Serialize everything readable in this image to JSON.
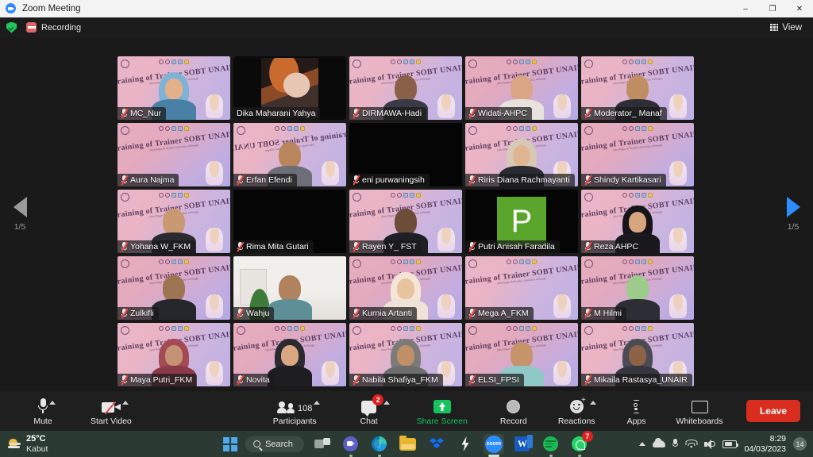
{
  "window": {
    "title": "Zoom Meeting",
    "app_icon": "zoom-logo-icon",
    "minimize": "–",
    "maximize": "❐",
    "close": "✕"
  },
  "topbar": {
    "encryption_icon": "green-shield-icon",
    "recording_icon": "recording-indicator-icon",
    "recording_label": "Recording",
    "view_label": "View",
    "view_icon": "grid-view-icon"
  },
  "gallery": {
    "virtual_background_title": "Training of Trainer SOBT UNAIR",
    "virtual_background_subtitle": "Sehat Bugar & Healthy Universitas Airlangga",
    "page_left": "1/5",
    "page_right": "1/5",
    "prev_icon": "chevron-left-icon",
    "next_icon": "chevron-right-icon",
    "participants": [
      {
        "name": "MC_Nur",
        "muted": true,
        "video": "vbg",
        "variant": "hijab",
        "skin": "#e3b089",
        "cloth": "#4a7fa6",
        "hijabcolor": "#7fb3d5"
      },
      {
        "name": "Dika Maharani Yahya",
        "muted": false,
        "video": "image",
        "active_speaker": true
      },
      {
        "name": "DIRMAWA-Hadi",
        "muted": true,
        "video": "vbg",
        "variant": "head",
        "skin": "#8a6148",
        "cloth": "#3a3a46"
      },
      {
        "name": "Widati-AHPC",
        "muted": true,
        "video": "vbg",
        "variant": "head",
        "skin": "#d9a585",
        "cloth": "#e8e2dd"
      },
      {
        "name": "Moderator_ Manaf",
        "muted": true,
        "video": "vbg",
        "variant": "head",
        "skin": "#c08e63",
        "cloth": "#2e2e38"
      },
      {
        "name": "Aura Najma",
        "muted": true,
        "video": "vbg",
        "variant": "none"
      },
      {
        "name": "Erfan Efendi",
        "muted": true,
        "video": "vbg_flip",
        "variant": "head",
        "skin": "#b9855c",
        "cloth": "#6e6e78"
      },
      {
        "name": "eni purwaningsih",
        "muted": true,
        "video": "off"
      },
      {
        "name": "Riris Diana Rachmayanti",
        "muted": true,
        "video": "vbg",
        "variant": "hijab",
        "skin": "#e0b591",
        "cloth": "#2b2b33",
        "hijabcolor": "#d8c9b6"
      },
      {
        "name": "Shindy Kartikasari",
        "muted": true,
        "video": "vbg",
        "variant": "none"
      },
      {
        "name": "Yohana W_FKM",
        "muted": true,
        "video": "vbg",
        "variant": "head",
        "skin": "#c99a72",
        "cloth": "#2a2a31"
      },
      {
        "name": "Rima Mita Gutari",
        "muted": true,
        "video": "off"
      },
      {
        "name": "Rayen Y_ FST",
        "muted": true,
        "video": "vbg",
        "variant": "head",
        "skin": "#6d4c3a",
        "cloth": "#1f1f26"
      },
      {
        "name": "Putri Anisah Faradila",
        "muted": true,
        "video": "avatar",
        "avatar_letter": "P",
        "avatar_color": "#5aa52b"
      },
      {
        "name": "Reza AHPC",
        "muted": true,
        "video": "vbg",
        "variant": "hijab",
        "skin": "#d7a57e",
        "cloth": "#18181d",
        "hijabcolor": "#15151a"
      },
      {
        "name": "Zulkifli",
        "muted": true,
        "video": "vbg",
        "variant": "head",
        "skin": "#9e7552",
        "cloth": "#26262d"
      },
      {
        "name": "Wahju",
        "muted": true,
        "video": "room",
        "variant": "head",
        "skin": "#b0825d",
        "cloth": "#5e8f97"
      },
      {
        "name": "Kurnia Artanti",
        "muted": true,
        "video": "vbg",
        "variant": "hijab",
        "skin": "#e8c3a0",
        "cloth": "#efe2d6",
        "hijabcolor": "#f3e6d7"
      },
      {
        "name": "Mega A_FKM",
        "muted": true,
        "video": "vbg",
        "variant": "none"
      },
      {
        "name": "M Hilmi",
        "muted": true,
        "video": "vbg",
        "variant": "head",
        "skin": "#9ccb8c",
        "cloth": "#2d2d35"
      },
      {
        "name": "Maya Putri_FKM",
        "muted": true,
        "video": "vbg",
        "variant": "hijab",
        "skin": "#c49274",
        "cloth": "#8b3a4a",
        "hijabcolor": "#a44a55"
      },
      {
        "name": "Novita",
        "muted": true,
        "video": "vbg",
        "variant": "hijab",
        "skin": "#d9a882",
        "cloth": "#1d1d22",
        "hijabcolor": "#2a2a30"
      },
      {
        "name": "Nabila Shafiya_FKM",
        "muted": true,
        "video": "vbg",
        "variant": "hijab",
        "skin": "#c08e67",
        "cloth": "#6e6e6e",
        "hijabcolor": "#7b7b78"
      },
      {
        "name": "ELSI_FPSI",
        "muted": true,
        "video": "vbg",
        "variant": "head",
        "skin": "#c6936b",
        "cloth": "#8fc8c6"
      },
      {
        "name": "Mikaila Rastasya_UNAIR",
        "muted": true,
        "video": "vbg",
        "variant": "hijab",
        "skin": "#8d6247",
        "cloth": "#37373f",
        "hijabcolor": "#4b4b55"
      }
    ]
  },
  "toolbar": {
    "mute_label": "Mute",
    "mute_icon": "microphone-icon",
    "start_video_label": "Start Video",
    "start_video_icon": "camera-off-icon",
    "participants_label": "Participants",
    "participants_icon": "people-icon",
    "participants_count": "108",
    "chat_label": "Chat",
    "chat_icon": "chat-bubble-icon",
    "chat_badge": "2",
    "share_screen_label": "Share Screen",
    "share_screen_icon": "share-screen-icon",
    "record_label": "Record",
    "record_icon": "record-circle-icon",
    "reactions_label": "Reactions",
    "reactions_icon": "smiley-reaction-icon",
    "apps_label": "Apps",
    "apps_icon": "apps-bracket-icon",
    "whiteboards_label": "Whiteboards",
    "whiteboards_icon": "whiteboard-icon",
    "leave_label": "Leave",
    "accent_green": "#16c45f",
    "leave_red": "#d92d20"
  },
  "taskbar": {
    "weather_temp": "25°C",
    "weather_desc": "Kabut",
    "weather_icon": "fog-sun-icon",
    "start_icon": "windows-start-icon",
    "search_placeholder": "Search",
    "search_icon": "search-icon",
    "apps": [
      {
        "name": "task-view",
        "icon": "task-view-icon"
      },
      {
        "name": "teams",
        "icon": "teams-icon"
      },
      {
        "name": "edge",
        "icon": "edge-icon"
      },
      {
        "name": "file-explorer",
        "icon": "folder-icon"
      },
      {
        "name": "dropbox",
        "icon": "dropbox-icon"
      },
      {
        "name": "lightning-app",
        "icon": "lightning-icon"
      },
      {
        "name": "zoom",
        "icon": "zoom-icon",
        "label": "zoom",
        "active": true
      },
      {
        "name": "word",
        "icon": "word-icon",
        "label": "W"
      },
      {
        "name": "spotify",
        "icon": "spotify-icon"
      },
      {
        "name": "whatsapp",
        "icon": "whatsapp-icon",
        "badge": "7"
      }
    ],
    "tray": {
      "chevron_icon": "tray-chevron-up-icon",
      "onedrive_icon": "cloud-icon",
      "mic_icon": "microphone-icon",
      "wifi_icon": "wifi-icon",
      "volume_icon": "volume-icon",
      "battery_icon": "battery-icon",
      "time": "8:29",
      "date": "04/03/2023",
      "notification_count": "14"
    }
  }
}
